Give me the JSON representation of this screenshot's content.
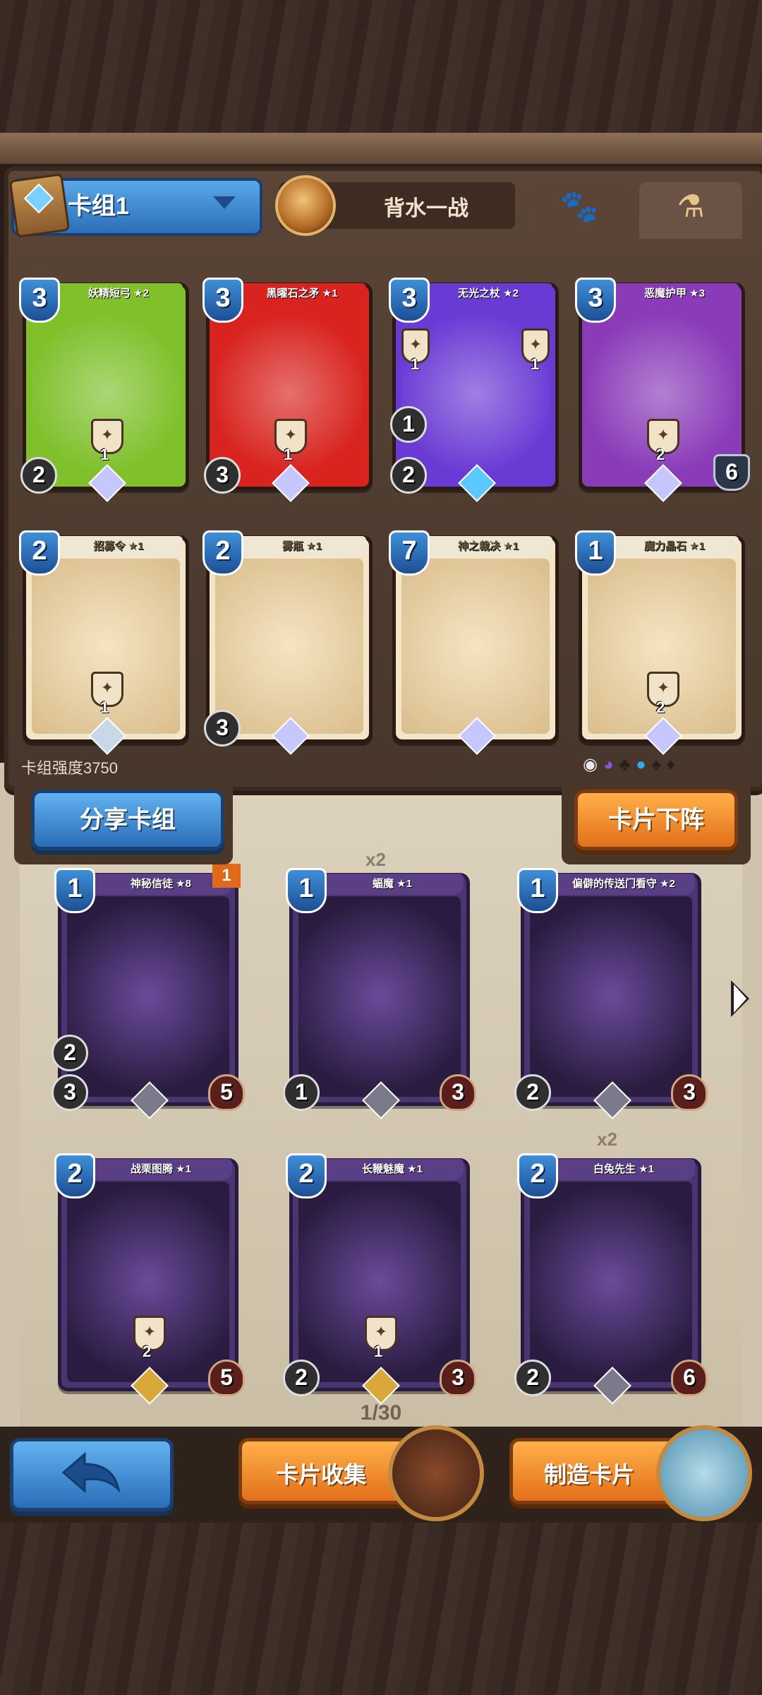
{
  "deck": {
    "name": "卡组1",
    "hero_name": "背水一战",
    "strength_label": "卡组强度3750",
    "tabs": [
      "paw-tab",
      "potion-tab"
    ]
  },
  "deck_cards": [
    {
      "name": "妖精短弓 ★2",
      "cost": "3",
      "attack": "2",
      "ability_count": "1",
      "color": "#7fc02b",
      "gem": "#c7c7ff"
    },
    {
      "name": "黑曜石之矛 ★1",
      "cost": "3",
      "attack": "3",
      "ability_count": "1",
      "color": "#d8231f",
      "gem": "#c7c7ff"
    },
    {
      "name": "无光之杖 ★2",
      "cost": "3",
      "attack": "2",
      "attack_top": "1",
      "ability_count_left": "1",
      "ability_count_right": "1",
      "color": "#6a3bd4",
      "gem": "#5bc8ff"
    },
    {
      "name": "恶魔护甲 ★3",
      "cost": "3",
      "shield": "6",
      "ability_count": "2",
      "color": "#8a3bb8",
      "gem": "#c7c7ff"
    },
    {
      "name": "招募令 ★1",
      "cost": "2",
      "ability_count": "1",
      "color": "#e8d2a8",
      "gem": "#c9d8e8"
    },
    {
      "name": "雾瓶 ★1",
      "cost": "2",
      "attack": "3",
      "color": "#e8d2a8",
      "gem": "#c7c7ff"
    },
    {
      "name": "神之裁决 ★1",
      "cost": "7",
      "color": "#e8d2a8",
      "gem": "#c7c7ff"
    },
    {
      "name": "魔力晶石 ★1",
      "cost": "1",
      "ability_count": "2",
      "color": "#d9d9d9",
      "gem": "#c7c7ff"
    }
  ],
  "buttons": {
    "share": "分享卡组",
    "remove": "卡片下阵",
    "back": "back",
    "collection": "卡片收集",
    "craft": "制造卡片"
  },
  "collection_cards": [
    {
      "name": "神秘信徒 ★8",
      "cost": "1",
      "attack": "3",
      "hp": "5",
      "dice": "2",
      "flag": "1",
      "badge": ""
    },
    {
      "name": "蝠魔 ★1",
      "cost": "1",
      "attack": "1",
      "hp": "3",
      "badge": "x2"
    },
    {
      "name": "偏僻的传送门看守 ★2",
      "cost": "1",
      "dice": "2",
      "hp": "3",
      "badge": ""
    },
    {
      "name": "战栗图腾 ★1",
      "cost": "2",
      "hp": "5",
      "ability_count": "2",
      "badge": ""
    },
    {
      "name": "长鞭魅魔 ★1",
      "cost": "2",
      "attack": "2",
      "hp": "3",
      "ability_count": "1",
      "badge": ""
    },
    {
      "name": "白兔先生 ★1",
      "cost": "2",
      "dice": "2",
      "hp": "6",
      "badge": "x2"
    }
  ],
  "x2_label": "x2",
  "page_indicator": "1/30"
}
